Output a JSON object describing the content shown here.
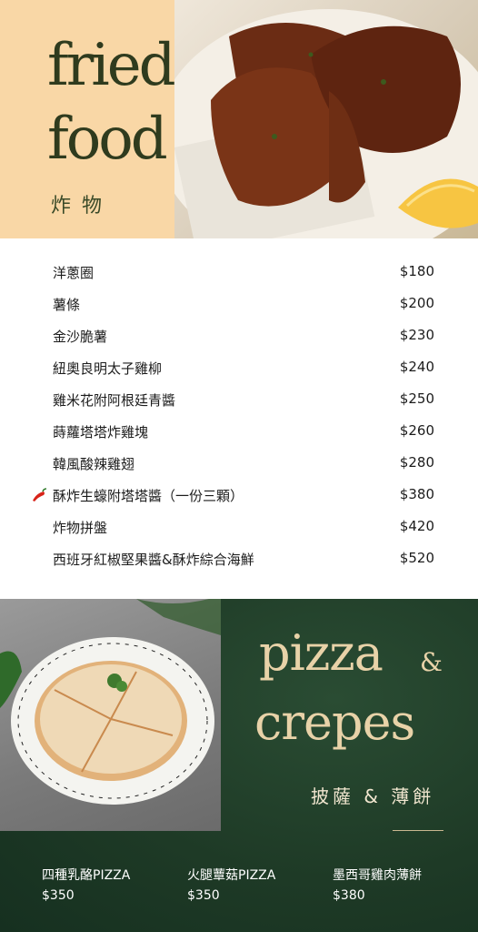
{
  "fried_food": {
    "title_line1": "fried",
    "title_line2": "food",
    "title_zh": "炸物",
    "items": [
      {
        "name": "洋蔥圈",
        "price": "$180"
      },
      {
        "name": "薯條",
        "price": "$200"
      },
      {
        "name": "金沙脆薯",
        "price": "$230"
      },
      {
        "name": "紐奧良明太子雞柳",
        "price": "$240"
      },
      {
        "name": "雞米花附阿根廷青醬",
        "price": "$250"
      },
      {
        "name": "蒔蘿塔塔炸雞塊",
        "price": "$260"
      },
      {
        "name": "韓風酸辣雞翅",
        "price": "$280"
      },
      {
        "name": "酥炸生蠔附塔塔醬（一份三顆）",
        "price": "$380",
        "icon": "chili-pepper-icon"
      },
      {
        "name": "炸物拼盤",
        "price": "$420"
      },
      {
        "name": "西班牙紅椒堅果醬&酥炸綜合海鮮",
        "price": "$520"
      }
    ]
  },
  "pizza_crepes": {
    "title_line1": "pizza",
    "ampersand": "&",
    "title_line2": "crepes",
    "title_zh": "披薩 & 薄餅",
    "items": [
      {
        "name": "四種乳酪PIZZA",
        "price": "$350"
      },
      {
        "name": "火腿蕈菇PIZZA",
        "price": "$350"
      },
      {
        "name": "墨西哥雞肉薄餅",
        "price": "$380"
      }
    ]
  },
  "colors": {
    "peach": "#f9d7a6",
    "dark_green": "#1e3a26",
    "gold": "#e8d2a8",
    "olive_text": "#2f3b1e"
  }
}
